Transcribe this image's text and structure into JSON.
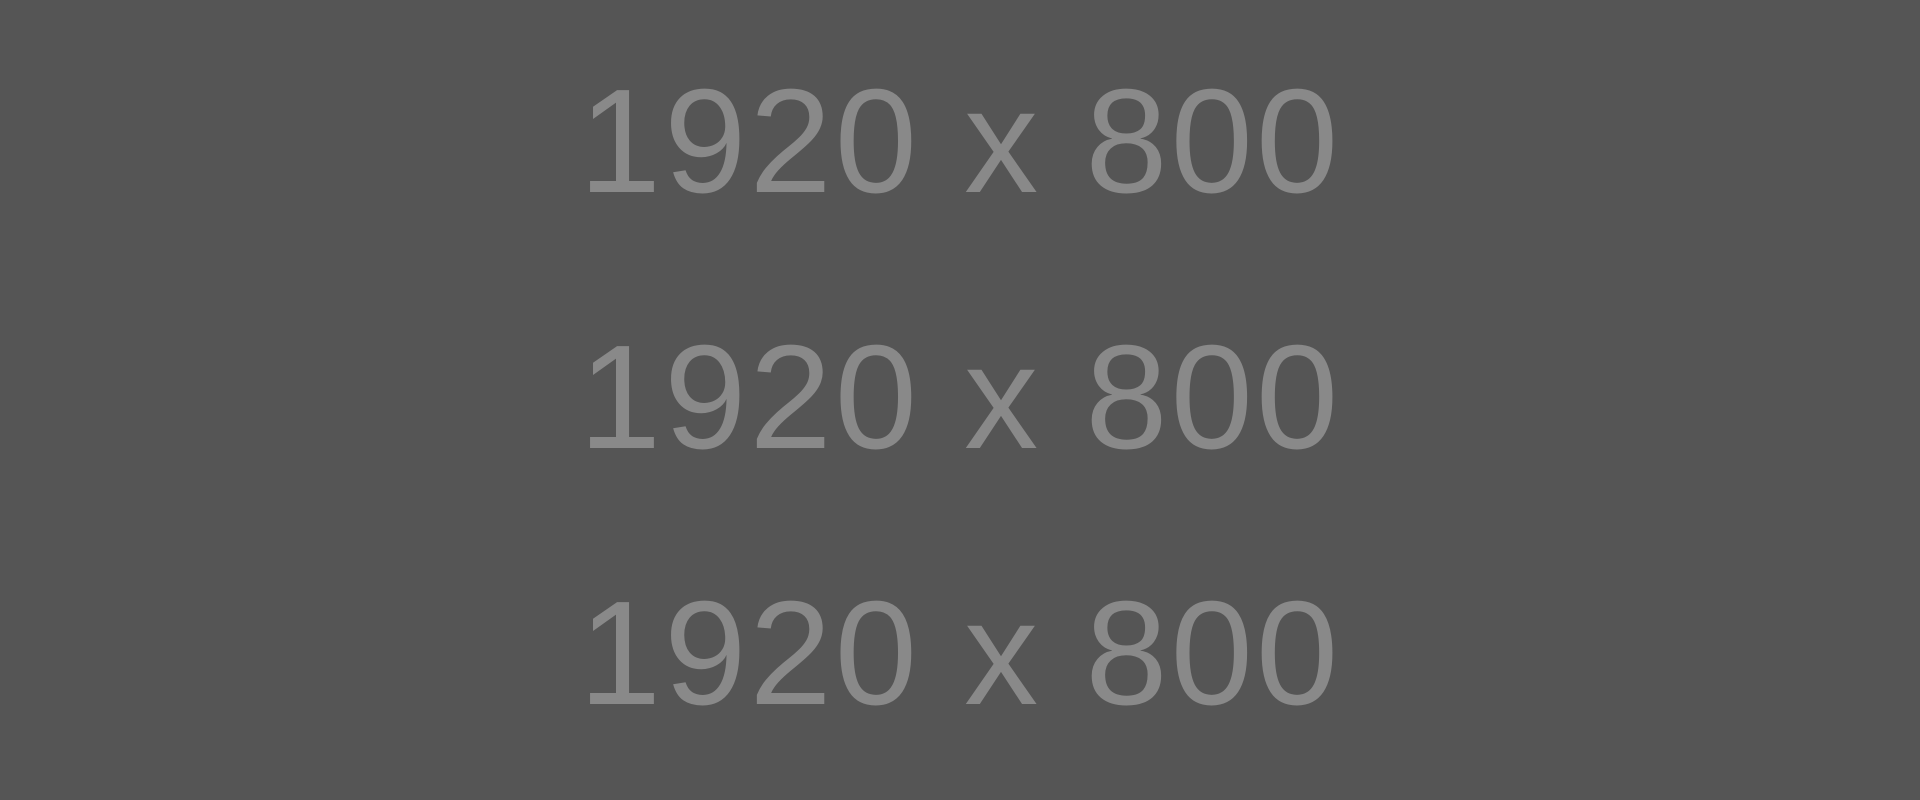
{
  "colors": {
    "background": "#555555",
    "text": "#898989"
  },
  "placeholder": {
    "lines": [
      "1920 x 800",
      "1920 x 800",
      "1920 x 800"
    ]
  }
}
